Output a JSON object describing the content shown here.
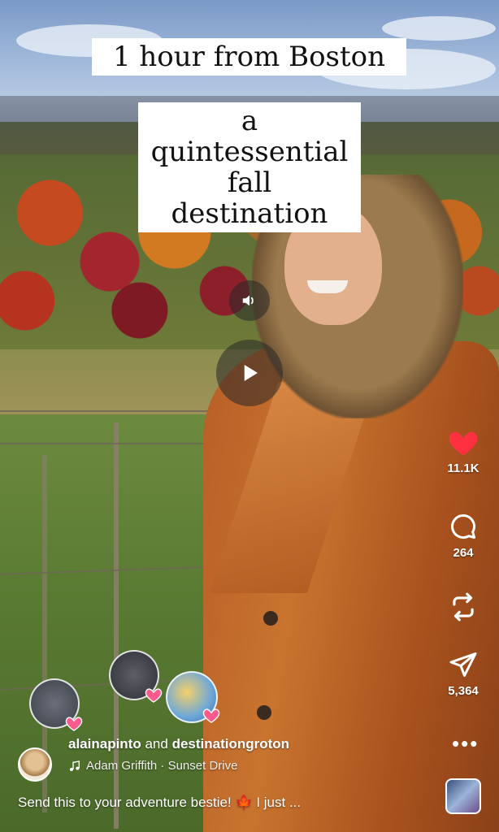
{
  "overlay": {
    "caption_top": "1 hour from Boston",
    "caption_sub": "a quintessential fall destination"
  },
  "controls": {
    "sound_icon": "speaker-icon",
    "play_icon": "play-icon"
  },
  "actions": {
    "likes": "11.1K",
    "comments": "264",
    "shares": "5,364",
    "like_color": "#ff3040"
  },
  "post": {
    "author": "alainapinto",
    "connector": "and",
    "collaborator": "destinationgroton",
    "audio": "Adam Griffith · Sunset Drive",
    "caption": "Send this to your adventure bestie! 🍁 I just ..."
  }
}
